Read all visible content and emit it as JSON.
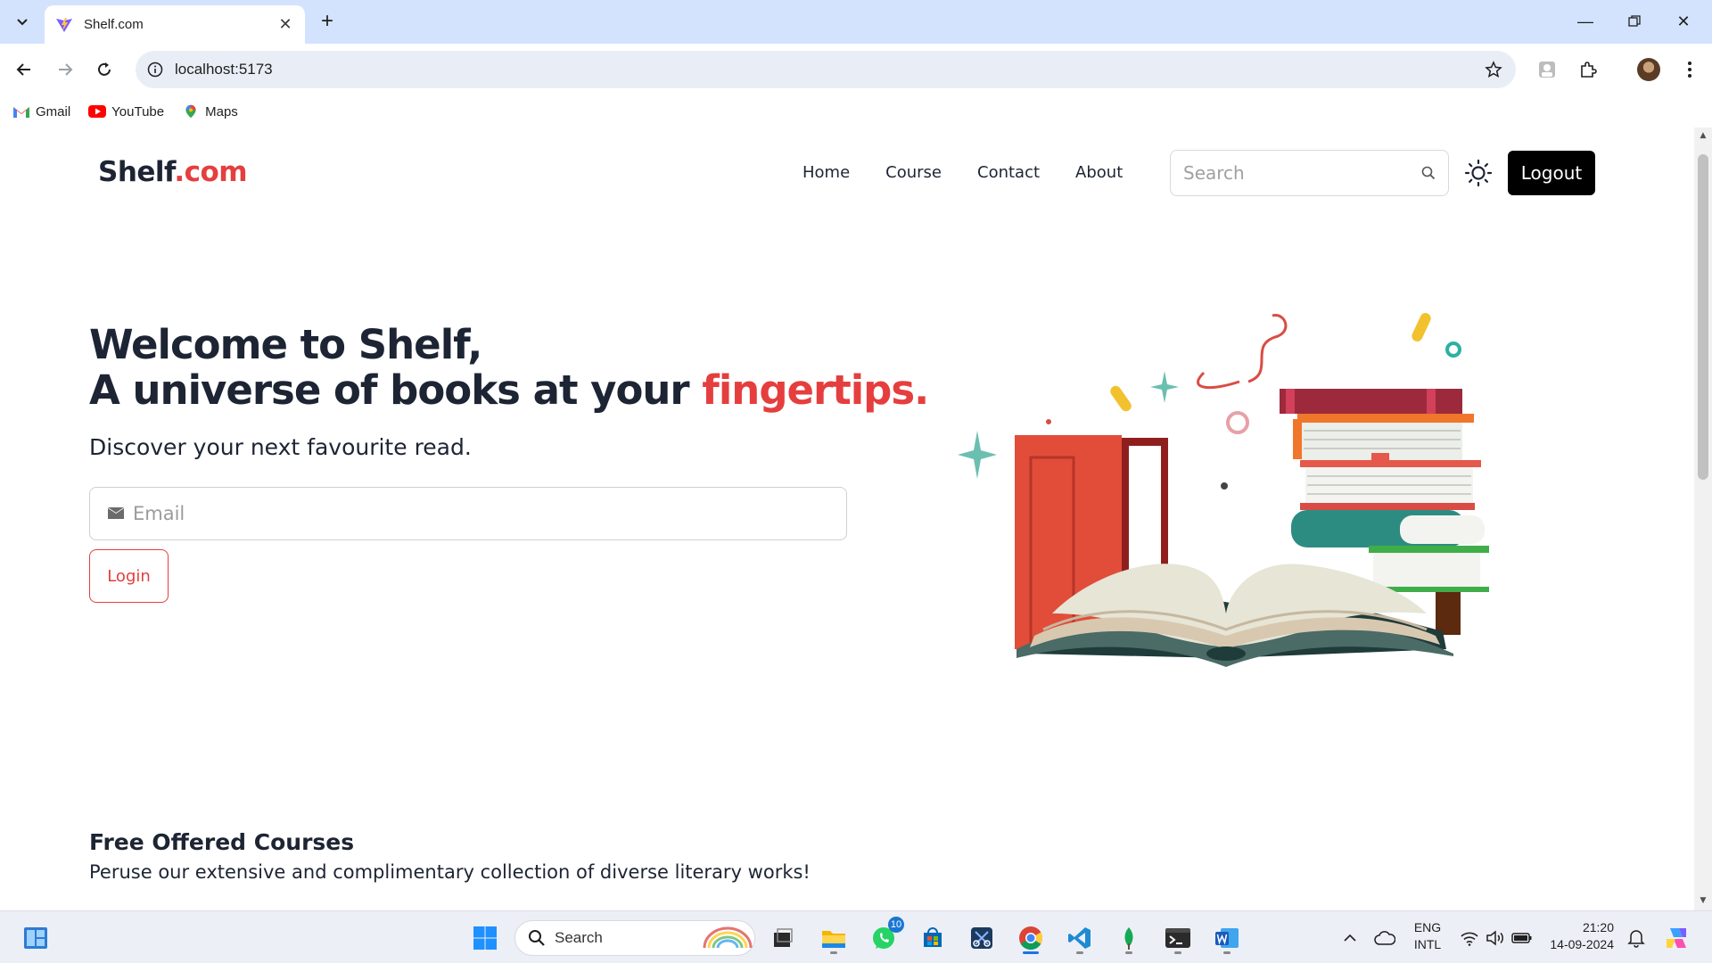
{
  "browser": {
    "tab_title": "Shelf.com",
    "url": "localhost:5173",
    "bookmarks": [
      {
        "label": "Gmail",
        "icon": "gmail-icon"
      },
      {
        "label": "YouTube",
        "icon": "youtube-icon"
      },
      {
        "label": "Maps",
        "icon": "maps-icon"
      }
    ]
  },
  "site": {
    "brand_main": "Shelf",
    "brand_accent": ".com",
    "nav": [
      "Home",
      "Course",
      "Contact",
      "About"
    ],
    "search_placeholder": "Search",
    "logout_label": "Logout",
    "accent_color": "#e53e3e"
  },
  "hero": {
    "line1": "Welcome to Shelf,",
    "line2_prefix": "A universe of books at your ",
    "line2_accent": "fingertips.",
    "subtitle": "Discover your next favourite read.",
    "email_placeholder": "Email",
    "login_label": "Login"
  },
  "courses": {
    "title": "Free Offered Courses",
    "subtitle": "Peruse our extensive and complimentary collection of diverse literary works!"
  },
  "taskbar": {
    "search_placeholder": "Search",
    "whatsapp_badge": "10",
    "lang_line1": "ENG",
    "lang_line2": "INTL",
    "time": "21:20",
    "date": "14-09-2024"
  }
}
